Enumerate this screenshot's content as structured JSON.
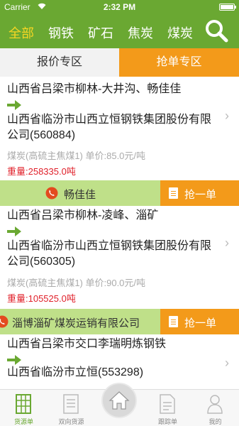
{
  "status_bar": {
    "carrier": "Carrier",
    "time": "2:32 PM"
  },
  "categories": [
    {
      "label": "全部",
      "active": true
    },
    {
      "label": "钢铁"
    },
    {
      "label": "矿石"
    },
    {
      "label": "焦炭"
    },
    {
      "label": "煤炭"
    }
  ],
  "tabs": {
    "left": "报价专区",
    "right": "抢单专区"
  },
  "grab_label": "抢一单",
  "cards": [
    {
      "origin": "山西省吕梁市柳林-大井沟、畅佳佳",
      "dest": "山西省临汾市山西立恒钢铁集团股份有限公司(560884)",
      "goods": "煤炭(高硫主焦煤1)  单价:85.0元/吨",
      "weight": "重量:258335.0吨",
      "contact": "畅佳佳"
    },
    {
      "origin": "山西省吕梁市柳林-凌峰、淄矿",
      "dest": "山西省临汾市山西立恒钢铁集团股份有限公司(560305)",
      "goods": "煤炭(高硫主焦煤1)  单价:90.0元/吨",
      "weight": "重量:105525.0吨",
      "contact": "淄博淄矿煤炭运销有限公司"
    },
    {
      "origin": "山西省吕梁市交口李瑞明炼钢铁",
      "dest": "山西省临汾市立恒(553298)"
    }
  ],
  "nav": [
    {
      "label": "货源单",
      "icon": "grid-icon",
      "active": true
    },
    {
      "label": "双向货源",
      "icon": "document-icon"
    },
    {
      "label": "",
      "icon": "home-icon"
    },
    {
      "label": "跟踪单",
      "icon": "tracking-document-icon"
    },
    {
      "label": "我的",
      "icon": "person-icon"
    }
  ],
  "colors": {
    "brand_green": "#6aa832",
    "accent_orange": "#f39a1a",
    "highlight_yellow": "#f5d623",
    "contact_green": "#bfe089",
    "weight_red": "#e0202a"
  }
}
